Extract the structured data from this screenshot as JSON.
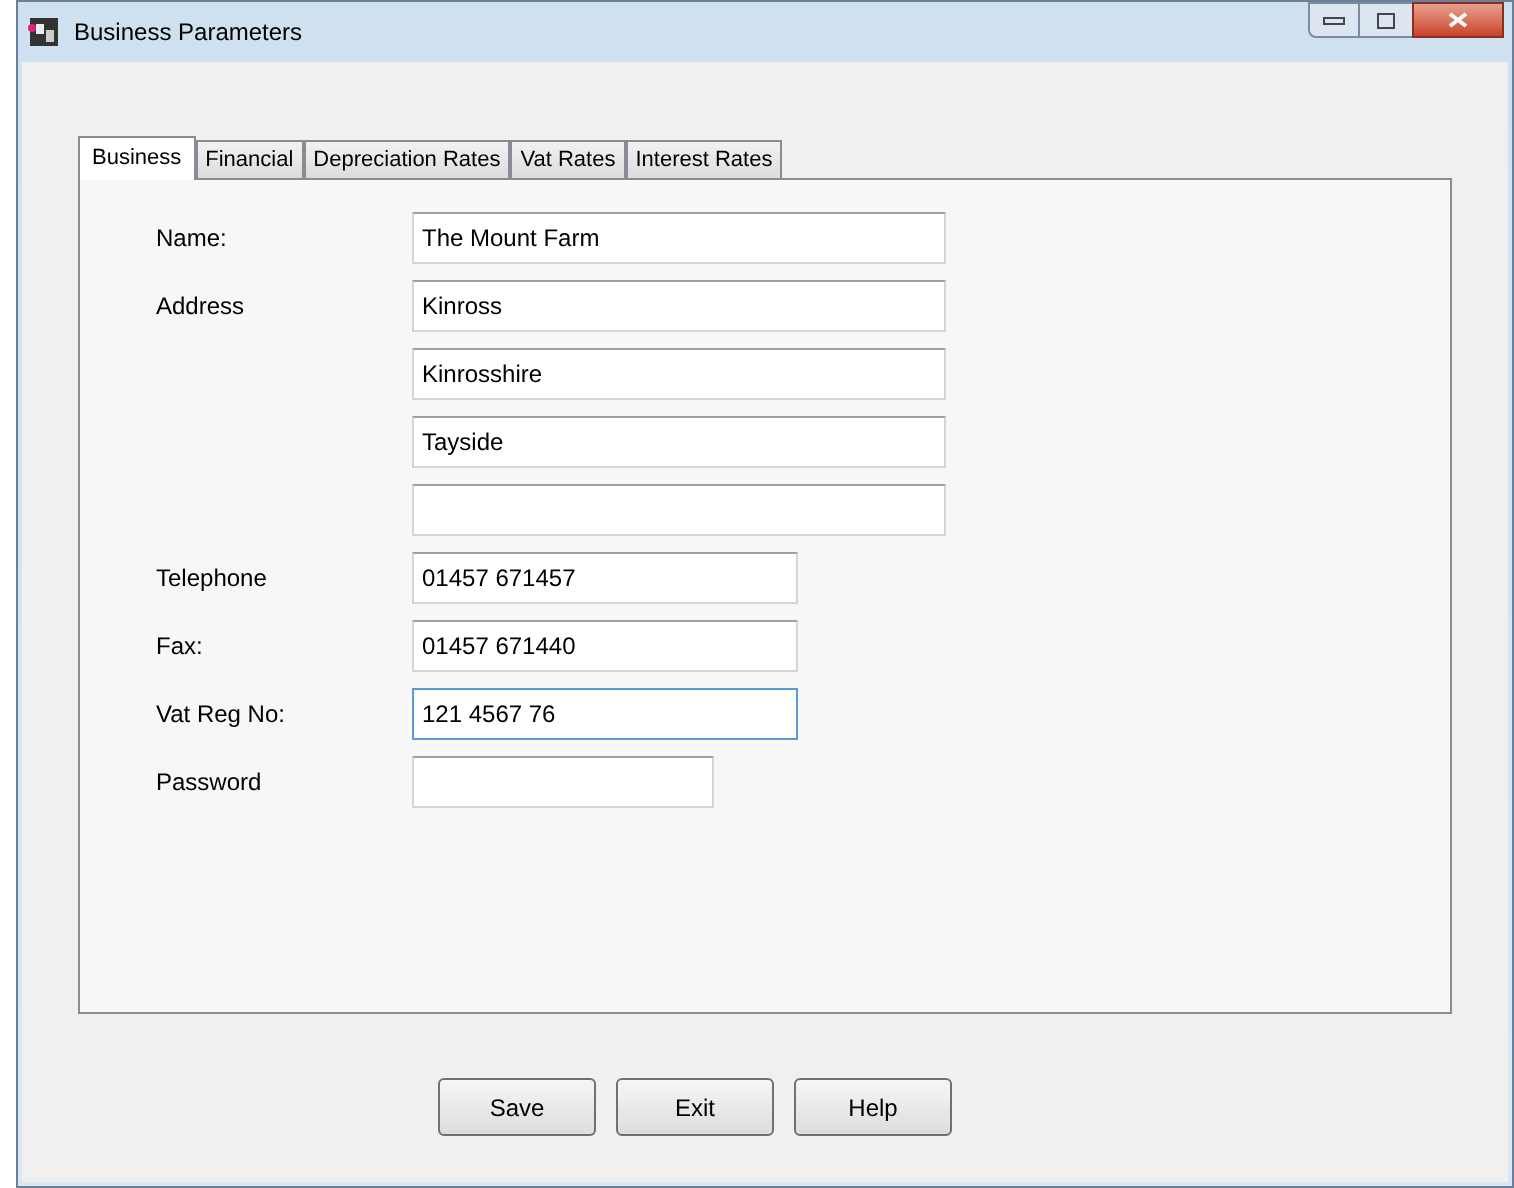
{
  "window": {
    "title": "Business Parameters"
  },
  "tabs": [
    {
      "label": "Business",
      "selected": true
    },
    {
      "label": "Financial",
      "selected": false
    },
    {
      "label": "Depreciation Rates",
      "selected": false
    },
    {
      "label": "Vat Rates",
      "selected": false
    },
    {
      "label": "Interest Rates",
      "selected": false
    }
  ],
  "fields": [
    {
      "kind": "long",
      "label": "Name:",
      "value": "The Mount Farm",
      "focused": false
    },
    {
      "kind": "long",
      "label": "Address",
      "value": "Kinross",
      "focused": false
    },
    {
      "kind": "long",
      "value": "Kinrosshire",
      "focused": false
    },
    {
      "kind": "long",
      "value": "Tayside",
      "focused": false
    },
    {
      "kind": "long",
      "focused": false
    },
    {
      "kind": "medium",
      "label": "Telephone",
      "value": "01457 671457",
      "focused": false
    },
    {
      "kind": "medium",
      "label": "Fax:",
      "value": "01457 671440",
      "focused": false
    },
    {
      "kind": "medium",
      "label": "Vat Reg No:",
      "value": "121 4567 76",
      "focused": true
    },
    {
      "kind": "short",
      "label": "Password",
      "focused": false
    }
  ],
  "buttons": [
    "Save",
    "Exit",
    "Help"
  ]
}
